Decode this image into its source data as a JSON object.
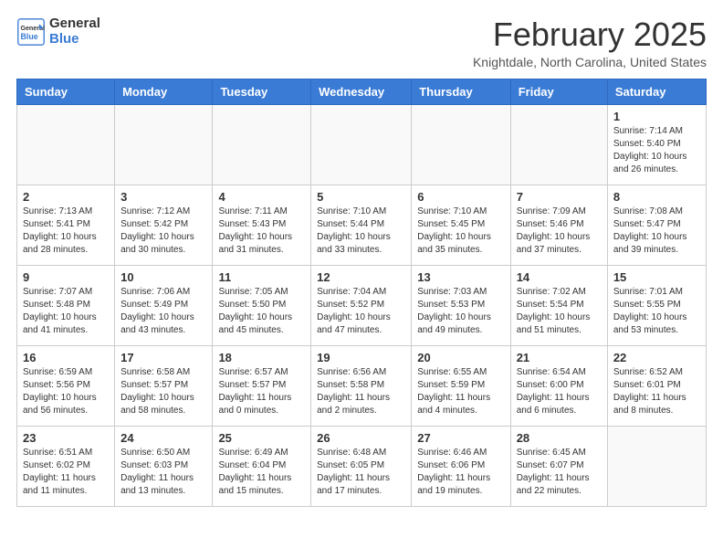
{
  "header": {
    "logo_general": "General",
    "logo_blue": "Blue",
    "month": "February 2025",
    "location": "Knightdale, North Carolina, United States"
  },
  "days_of_week": [
    "Sunday",
    "Monday",
    "Tuesday",
    "Wednesday",
    "Thursday",
    "Friday",
    "Saturday"
  ],
  "weeks": [
    [
      {
        "num": "",
        "info": ""
      },
      {
        "num": "",
        "info": ""
      },
      {
        "num": "",
        "info": ""
      },
      {
        "num": "",
        "info": ""
      },
      {
        "num": "",
        "info": ""
      },
      {
        "num": "",
        "info": ""
      },
      {
        "num": "1",
        "info": "Sunrise: 7:14 AM\nSunset: 5:40 PM\nDaylight: 10 hours and 26 minutes."
      }
    ],
    [
      {
        "num": "2",
        "info": "Sunrise: 7:13 AM\nSunset: 5:41 PM\nDaylight: 10 hours and 28 minutes."
      },
      {
        "num": "3",
        "info": "Sunrise: 7:12 AM\nSunset: 5:42 PM\nDaylight: 10 hours and 30 minutes."
      },
      {
        "num": "4",
        "info": "Sunrise: 7:11 AM\nSunset: 5:43 PM\nDaylight: 10 hours and 31 minutes."
      },
      {
        "num": "5",
        "info": "Sunrise: 7:10 AM\nSunset: 5:44 PM\nDaylight: 10 hours and 33 minutes."
      },
      {
        "num": "6",
        "info": "Sunrise: 7:10 AM\nSunset: 5:45 PM\nDaylight: 10 hours and 35 minutes."
      },
      {
        "num": "7",
        "info": "Sunrise: 7:09 AM\nSunset: 5:46 PM\nDaylight: 10 hours and 37 minutes."
      },
      {
        "num": "8",
        "info": "Sunrise: 7:08 AM\nSunset: 5:47 PM\nDaylight: 10 hours and 39 minutes."
      }
    ],
    [
      {
        "num": "9",
        "info": "Sunrise: 7:07 AM\nSunset: 5:48 PM\nDaylight: 10 hours and 41 minutes."
      },
      {
        "num": "10",
        "info": "Sunrise: 7:06 AM\nSunset: 5:49 PM\nDaylight: 10 hours and 43 minutes."
      },
      {
        "num": "11",
        "info": "Sunrise: 7:05 AM\nSunset: 5:50 PM\nDaylight: 10 hours and 45 minutes."
      },
      {
        "num": "12",
        "info": "Sunrise: 7:04 AM\nSunset: 5:52 PM\nDaylight: 10 hours and 47 minutes."
      },
      {
        "num": "13",
        "info": "Sunrise: 7:03 AM\nSunset: 5:53 PM\nDaylight: 10 hours and 49 minutes."
      },
      {
        "num": "14",
        "info": "Sunrise: 7:02 AM\nSunset: 5:54 PM\nDaylight: 10 hours and 51 minutes."
      },
      {
        "num": "15",
        "info": "Sunrise: 7:01 AM\nSunset: 5:55 PM\nDaylight: 10 hours and 53 minutes."
      }
    ],
    [
      {
        "num": "16",
        "info": "Sunrise: 6:59 AM\nSunset: 5:56 PM\nDaylight: 10 hours and 56 minutes."
      },
      {
        "num": "17",
        "info": "Sunrise: 6:58 AM\nSunset: 5:57 PM\nDaylight: 10 hours and 58 minutes."
      },
      {
        "num": "18",
        "info": "Sunrise: 6:57 AM\nSunset: 5:57 PM\nDaylight: 11 hours and 0 minutes."
      },
      {
        "num": "19",
        "info": "Sunrise: 6:56 AM\nSunset: 5:58 PM\nDaylight: 11 hours and 2 minutes."
      },
      {
        "num": "20",
        "info": "Sunrise: 6:55 AM\nSunset: 5:59 PM\nDaylight: 11 hours and 4 minutes."
      },
      {
        "num": "21",
        "info": "Sunrise: 6:54 AM\nSunset: 6:00 PM\nDaylight: 11 hours and 6 minutes."
      },
      {
        "num": "22",
        "info": "Sunrise: 6:52 AM\nSunset: 6:01 PM\nDaylight: 11 hours and 8 minutes."
      }
    ],
    [
      {
        "num": "23",
        "info": "Sunrise: 6:51 AM\nSunset: 6:02 PM\nDaylight: 11 hours and 11 minutes."
      },
      {
        "num": "24",
        "info": "Sunrise: 6:50 AM\nSunset: 6:03 PM\nDaylight: 11 hours and 13 minutes."
      },
      {
        "num": "25",
        "info": "Sunrise: 6:49 AM\nSunset: 6:04 PM\nDaylight: 11 hours and 15 minutes."
      },
      {
        "num": "26",
        "info": "Sunrise: 6:48 AM\nSunset: 6:05 PM\nDaylight: 11 hours and 17 minutes."
      },
      {
        "num": "27",
        "info": "Sunrise: 6:46 AM\nSunset: 6:06 PM\nDaylight: 11 hours and 19 minutes."
      },
      {
        "num": "28",
        "info": "Sunrise: 6:45 AM\nSunset: 6:07 PM\nDaylight: 11 hours and 22 minutes."
      },
      {
        "num": "",
        "info": ""
      }
    ]
  ]
}
